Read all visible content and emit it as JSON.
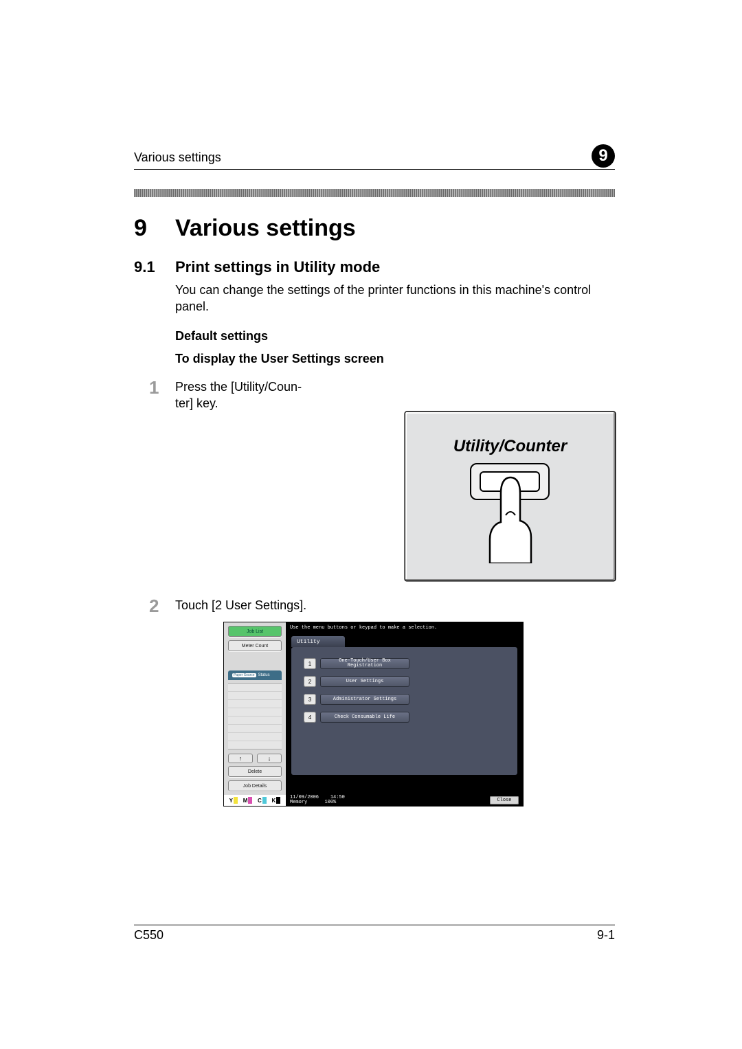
{
  "running_header": {
    "title": "Various settings",
    "chapter_badge": "9"
  },
  "h1": {
    "number": "9",
    "text": "Various settings"
  },
  "h2": {
    "number": "9.1",
    "text": "Print settings in Utility mode"
  },
  "intro": "You can change the settings of the printer functions in this machine's control panel.",
  "sub_heading_1": "Default settings",
  "sub_heading_2": "To display the User Settings screen",
  "steps": [
    {
      "num": "1",
      "text": "Press the [Utility/Coun-\nter] key."
    },
    {
      "num": "2",
      "text": "Touch [2 User Settings]."
    }
  ],
  "utility_key_label": "Utility/Counter",
  "panel": {
    "instruction": "Use the menu buttons or keypad to make a selection.",
    "side": {
      "job_list": "Job List",
      "meter_count": "Meter Count",
      "status_tab_mini": "Paper Source",
      "status_tab": "Status",
      "arrow_up": "↑",
      "arrow_down": "↓",
      "delete": "Delete",
      "job_details": "Job Details"
    },
    "utility_tab": "Utility",
    "menu_items": [
      {
        "n": "1",
        "label": "One-Touch/User Box Registration"
      },
      {
        "n": "2",
        "label": "User Settings"
      },
      {
        "n": "3",
        "label": "Administrator Settings"
      },
      {
        "n": "4",
        "label": "Check Consumable Life"
      }
    ],
    "status_bar": {
      "date": "11/09/2006",
      "time": "14:50",
      "memory_label": "Memory",
      "memory_value": "100%",
      "close": "Close"
    },
    "ymck": {
      "y": "Y",
      "m": "M",
      "c": "C",
      "k": "K"
    }
  },
  "footer": {
    "left": "C550",
    "right": "9-1"
  }
}
